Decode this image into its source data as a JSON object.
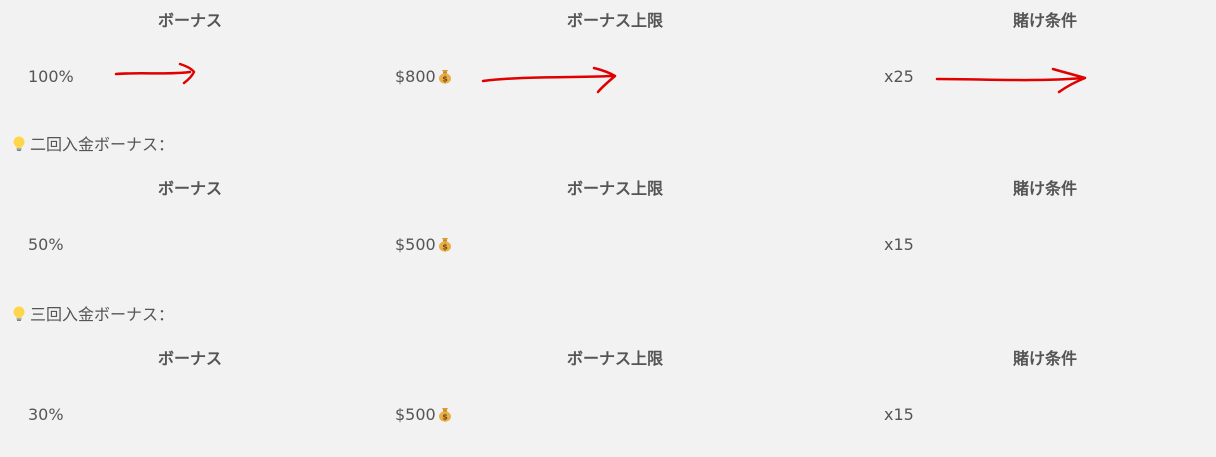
{
  "tables": [
    {
      "headers": [
        "ボーナス",
        "ボーナス上限",
        "賭け条件"
      ],
      "row": [
        "100%",
        "$800",
        "x25"
      ]
    },
    {
      "section_title": "二回入金ボーナス：",
      "headers": [
        "ボーナス",
        "ボーナス上限",
        "賭け条件"
      ],
      "row": [
        "50%",
        "$500",
        "x15"
      ]
    },
    {
      "section_title": "三回入金ボーナス：",
      "headers": [
        "ボーナス",
        "ボーナス上限",
        "賭け条件"
      ],
      "row": [
        "30%",
        "$500",
        "x15"
      ]
    }
  ],
  "icons": {
    "section_icon": "light-bulb-icon",
    "value_icon": "money-bag-icon",
    "annotation": "red-arrow"
  },
  "colors": {
    "background": "#f2f2f2",
    "text": "#555555",
    "annotation_red": "#e00000"
  }
}
